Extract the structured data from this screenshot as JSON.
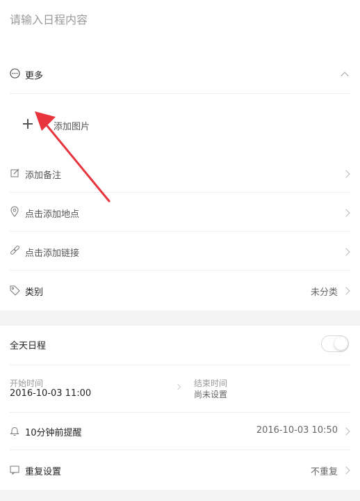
{
  "title_input": {
    "placeholder": "请输入日程内容"
  },
  "more_section": {
    "label": "更多"
  },
  "add_image": {
    "label": "添加图片"
  },
  "menu": [
    {
      "label": "添加备注"
    },
    {
      "label": "点击添加地点"
    },
    {
      "label": "点击添加链接"
    }
  ],
  "category": {
    "label": "类别",
    "value": "未分类"
  },
  "all_day": {
    "label": "全天日程",
    "enabled": false
  },
  "start_time": {
    "label": "开始时间",
    "value": "2016-10-03 11:00"
  },
  "end_time": {
    "label": "结束时间",
    "value": "尚未设置"
  },
  "reminder": {
    "label": "10分钟前提醒",
    "value": "2016-10-03 10:50"
  },
  "repeat": {
    "label": "重复设置",
    "value": "不重复"
  },
  "colors": {
    "annotation_arrow": "#e8343c",
    "band": "#f3f3f3"
  }
}
